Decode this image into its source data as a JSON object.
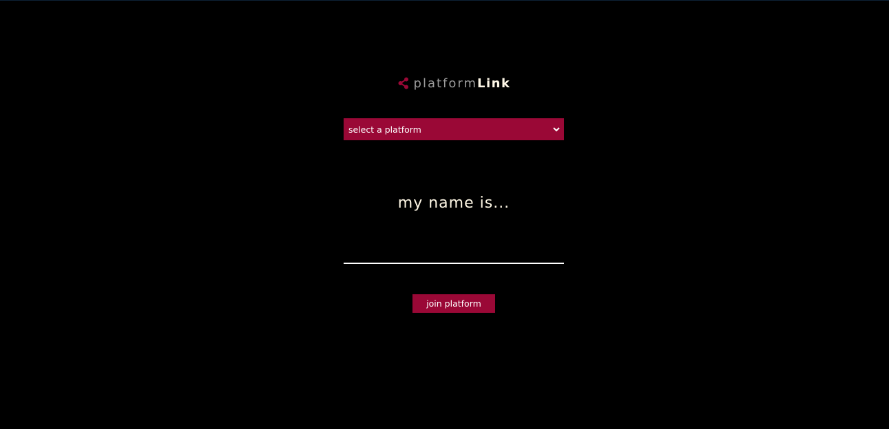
{
  "top_border_color": "#0d2236",
  "logo": {
    "icon": "share-icon",
    "text_light": "platform",
    "text_bold": "Link",
    "icon_color": "#9a0836"
  },
  "platform_select": {
    "selected": "select a platform",
    "icon": "chevron-down-icon",
    "background": "#9a0836"
  },
  "name_prompt": "my name is...",
  "name_input": {
    "value": "",
    "placeholder": ""
  },
  "join_button": {
    "label": "join platform",
    "background": "#9a0836"
  }
}
